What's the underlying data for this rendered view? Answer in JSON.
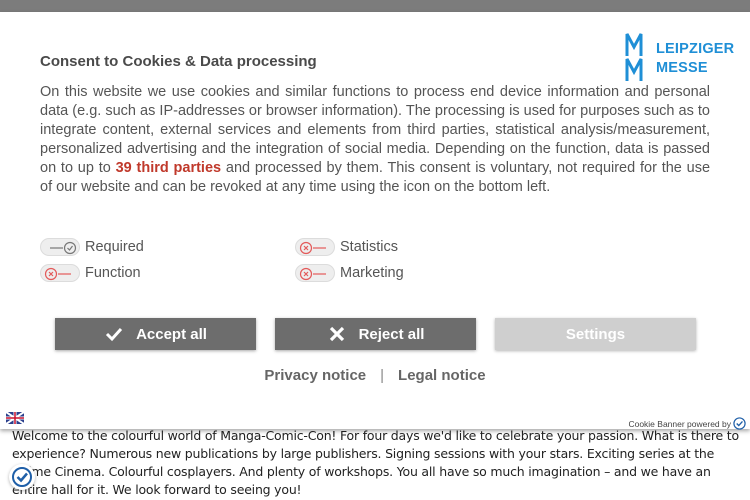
{
  "background_text": "Welcome to the colourful world of Manga-Comic-Con! For four days we'd like to celebrate your passion. What is there to experience? Numerous new publications by large publishers. Signing sessions with your stars. Exciting series at the Anime Cinema. Colourful cosplayers. And plenty of workshops. You all have so much imagination – and we have an entire hall for it. We look forward to seeing you!",
  "dialog": {
    "title": "Consent to Cookies & Data processing",
    "logo": {
      "line1": "LEIPZIGER",
      "line2": "MESSE",
      "color": "#1f8fd6",
      "icon": "leipziger-messe-mm-logo"
    },
    "description_before": "On this website we use cookies and similar functions to process end device information and personal data (e.g. such as IP-addresses or browser information). The processing is used for purposes such as to integrate content, external services and elements from third parties, statistical analysis/measurement, personalized advertising and the integration of social media. Depending on the function, data is passed on to up to ",
    "description_highlight": "39 third parties",
    "description_after": " and processed by them. This consent is voluntary, not required for the use of our website and can be revoked at any time using the icon on the bottom left.",
    "highlight_color": "#c0392b",
    "toggles": [
      {
        "label": "Required",
        "state": "on",
        "locked": true
      },
      {
        "label": "Statistics",
        "state": "off"
      },
      {
        "label": "Function",
        "state": "off"
      },
      {
        "label": "Marketing",
        "state": "off"
      }
    ],
    "buttons": {
      "accept": "Accept all",
      "reject": "Reject all",
      "settings": "Settings"
    },
    "links": {
      "privacy": "Privacy notice",
      "separator": "|",
      "legal": "Legal notice"
    },
    "footer": {
      "powered_by": "Cookie Banner powered by",
      "language_icon": "language-flag-icon"
    }
  },
  "colors": {
    "button_dark": "#6d6d6d",
    "button_light": "#cfcfcf",
    "text": "#555555",
    "off_icon": "#e35a5a"
  }
}
